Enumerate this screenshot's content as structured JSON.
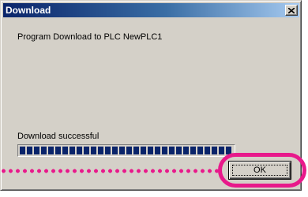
{
  "window": {
    "title": "Download",
    "close_icon": "close-x-icon"
  },
  "dialog": {
    "message": "Program Download to PLC NewPLC1",
    "status": "Download successful",
    "progress_percent": 100,
    "ok_label": "OK"
  },
  "annotation": {
    "highlight_color": "#e8198b",
    "target": "ok-button"
  },
  "colors": {
    "title_start": "#0a246a",
    "title_end": "#a6caf0",
    "face": "#d4d0c8",
    "progress_fill": "#0a246a"
  }
}
